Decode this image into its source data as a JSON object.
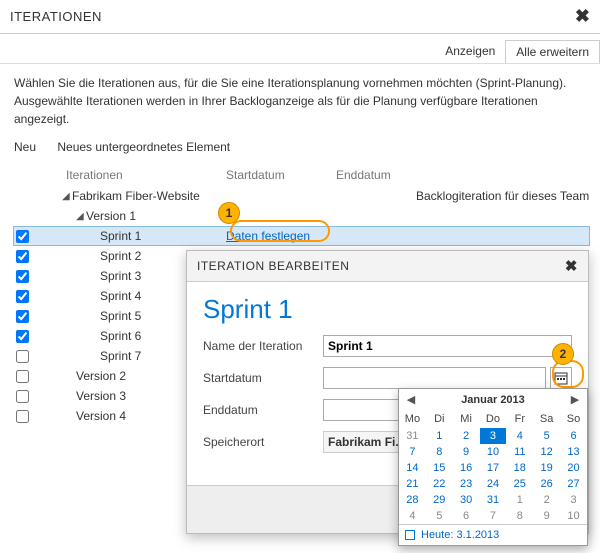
{
  "header": {
    "title": "ITERATIONEN",
    "close": "✖"
  },
  "toolbar": {
    "show": "Anzeigen",
    "expand": "Alle erweitern"
  },
  "intro": "Wählen Sie die Iterationen aus, für die Sie eine Iterationsplanung vornehmen möchten (Sprint-Planung). Ausgewählte Iterationen werden in Ihrer Backloganzeige als für die Planung verfügbare Iterationen angezeigt.",
  "menu": {
    "new": "Neu",
    "newchild": "Neues untergeordnetes Element"
  },
  "columns": {
    "iter": "Iterationen",
    "start": "Startdatum",
    "end": "Enddatum"
  },
  "backlog_text": "Backlogiteration für dieses Team",
  "set_dates": "Daten festlegen",
  "tree": {
    "root": "Fabrikam Fiber-Website",
    "v1": "Version 1",
    "sprints": [
      "Sprint 1",
      "Sprint 2",
      "Sprint 3",
      "Sprint 4",
      "Sprint 5",
      "Sprint 6",
      "Sprint 7"
    ],
    "versions": [
      "Version 2",
      "Version 3",
      "Version 4"
    ]
  },
  "callouts": {
    "one": "1",
    "two": "2"
  },
  "panel": {
    "title": "ITERATION BEARBEITEN",
    "close": "✖",
    "heading": "Sprint 1",
    "name_label": "Name der Iteration",
    "name_value": "Sprint 1",
    "start_label": "Startdatum",
    "start_value": "",
    "end_label": "Enddatum",
    "end_value": "",
    "loc_label": "Speicherort",
    "loc_value": "Fabrikam Fi..."
  },
  "calendar": {
    "month": "Januar 2013",
    "days": [
      "Mo",
      "Di",
      "Mi",
      "Do",
      "Fr",
      "Sa",
      "So"
    ],
    "weeks": [
      [
        {
          "d": "31",
          "o": true
        },
        {
          "d": "1"
        },
        {
          "d": "2"
        },
        {
          "d": "3",
          "today": true
        },
        {
          "d": "4"
        },
        {
          "d": "5"
        },
        {
          "d": "6"
        }
      ],
      [
        {
          "d": "7"
        },
        {
          "d": "8"
        },
        {
          "d": "9"
        },
        {
          "d": "10"
        },
        {
          "d": "11"
        },
        {
          "d": "12"
        },
        {
          "d": "13"
        }
      ],
      [
        {
          "d": "14"
        },
        {
          "d": "15"
        },
        {
          "d": "16"
        },
        {
          "d": "17"
        },
        {
          "d": "18"
        },
        {
          "d": "19"
        },
        {
          "d": "20"
        }
      ],
      [
        {
          "d": "21"
        },
        {
          "d": "22"
        },
        {
          "d": "23"
        },
        {
          "d": "24"
        },
        {
          "d": "25"
        },
        {
          "d": "26"
        },
        {
          "d": "27"
        }
      ],
      [
        {
          "d": "28"
        },
        {
          "d": "29"
        },
        {
          "d": "30"
        },
        {
          "d": "31"
        },
        {
          "d": "1",
          "o": true
        },
        {
          "d": "2",
          "o": true
        },
        {
          "d": "3",
          "o": true
        }
      ],
      [
        {
          "d": "4",
          "o": true
        },
        {
          "d": "5",
          "o": true
        },
        {
          "d": "6",
          "o": true
        },
        {
          "d": "7",
          "o": true
        },
        {
          "d": "8",
          "o": true
        },
        {
          "d": "9",
          "o": true
        },
        {
          "d": "10",
          "o": true
        }
      ]
    ],
    "today": "Heute: 3.1.2013"
  }
}
